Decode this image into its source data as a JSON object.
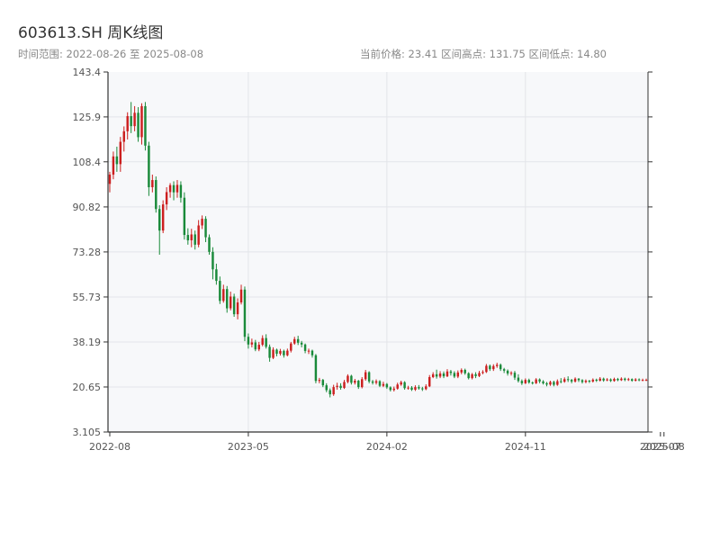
{
  "header": {
    "title": "603613.SH 周K线图",
    "range_text": "时间范围: 2022-08-26 至 2025-08-08",
    "stats_text": "当前价格: 23.41   区间高点: 131.75   区间低点: 14.80"
  },
  "colors": {
    "up": "#cc1f1f",
    "down": "#1a8a3a",
    "plot_bg": "#f7f8fa",
    "grid": "#e3e5e9",
    "axis": "#333333"
  },
  "chart_data": {
    "type": "candlestick",
    "title": "603613.SH 周K线图",
    "xlabel": "",
    "ylabel": "",
    "ylim": [
      3.105,
      143.4
    ],
    "y_ticks": [
      "3.105",
      "20.65",
      "38.19",
      "55.73",
      "73.28",
      "90.82",
      "108.4",
      "125.9",
      "143.4"
    ],
    "y_tick_values": [
      3.105,
      20.65,
      38.19,
      55.73,
      73.28,
      90.82,
      108.4,
      125.9,
      143.4
    ],
    "x_ticks": [
      "2022-08",
      "2023-05",
      "2024-02",
      "2024-11",
      "2025-07",
      "2025-08"
    ],
    "x_tick_index": [
      0,
      39,
      78,
      117,
      155,
      156
    ],
    "grid": true,
    "current_price": 23.41,
    "range_high": 131.75,
    "range_low": 14.8,
    "start": "2022-08-26",
    "end": "2025-08-08",
    "series": [
      {
        "values": [
          [
            99.8,
            103.4,
            96.5,
            104.5
          ],
          [
            103.4,
            110.5,
            101.6,
            112.4
          ],
          [
            110.5,
            107.5,
            104.5,
            114.3
          ],
          [
            107.5,
            116.2,
            104.5,
            118.1
          ],
          [
            116.2,
            120.3,
            112.4,
            122.2
          ],
          [
            120.3,
            126.2,
            117.1,
            127.7
          ],
          [
            126.2,
            122.3,
            119.6,
            131.7
          ],
          [
            122.3,
            127.5,
            120.3,
            130.1
          ],
          [
            127.5,
            118.0,
            116.2,
            129.7
          ],
          [
            118.0,
            130.1,
            115.1,
            131.2
          ],
          [
            130.1,
            114.7,
            112.8,
            131.7
          ],
          [
            114.7,
            98.5,
            95.1,
            116.2
          ],
          [
            98.5,
            101.3,
            96.5,
            103.4
          ],
          [
            101.3,
            90.0,
            88.6,
            102.7
          ],
          [
            90.0,
            81.6,
            72.2,
            91.5
          ],
          [
            81.6,
            91.8,
            80.6,
            93.4
          ],
          [
            91.8,
            96.6,
            89.6,
            98.5
          ],
          [
            96.6,
            99.3,
            94.4,
            100.1
          ],
          [
            99.3,
            96.5,
            93.4,
            100.8
          ],
          [
            96.5,
            99.4,
            94.4,
            101.3
          ],
          [
            99.4,
            94.4,
            92.5,
            100.8
          ],
          [
            94.4,
            79.9,
            78.1,
            96.5
          ],
          [
            79.9,
            77.8,
            76.1,
            82.5
          ],
          [
            77.8,
            80.1,
            75.1,
            82.3
          ],
          [
            80.1,
            76.1,
            74.2,
            81.6
          ],
          [
            76.1,
            83.6,
            75.1,
            85.7
          ],
          [
            83.6,
            86.2,
            82.2,
            87.5
          ],
          [
            86.2,
            79.0,
            77.1,
            87.2
          ],
          [
            79.0,
            73.3,
            72.2,
            80.1
          ],
          [
            73.3,
            66.5,
            62.6,
            75.1
          ],
          [
            66.5,
            62.0,
            60.5,
            68.7
          ],
          [
            62.0,
            54.2,
            53.0,
            63.7
          ],
          [
            54.2,
            58.8,
            53.5,
            60.5
          ],
          [
            58.8,
            51.3,
            49.6,
            60.0
          ],
          [
            51.3,
            55.9,
            50.5,
            57.8
          ],
          [
            55.9,
            49.0,
            48.0,
            57.0
          ],
          [
            49.0,
            53.6,
            47.0,
            55.2
          ],
          [
            53.6,
            58.6,
            52.8,
            60.5
          ],
          [
            58.6,
            40.2,
            38.5,
            59.8
          ],
          [
            40.2,
            37.2,
            35.6,
            41.5
          ],
          [
            37.2,
            38.0,
            36.1,
            39.5
          ],
          [
            38.0,
            35.3,
            34.6,
            39.0
          ],
          [
            35.3,
            37.1,
            34.6,
            38.2
          ],
          [
            37.1,
            39.7,
            36.5,
            40.8
          ],
          [
            39.7,
            36.3,
            35.6,
            41.2
          ],
          [
            36.3,
            32.0,
            30.5,
            37.2
          ],
          [
            32.0,
            35.2,
            31.5,
            36.1
          ],
          [
            35.2,
            33.6,
            32.6,
            35.6
          ],
          [
            33.6,
            34.7,
            32.9,
            35.5
          ],
          [
            34.7,
            33.0,
            32.1,
            35.2
          ],
          [
            33.0,
            34.8,
            32.6,
            35.6
          ],
          [
            34.8,
            37.6,
            34.1,
            38.2
          ],
          [
            37.6,
            39.3,
            37.1,
            40.2
          ],
          [
            39.3,
            37.9,
            37.0,
            40.6
          ],
          [
            37.9,
            37.2,
            36.1,
            38.6
          ],
          [
            37.2,
            34.7,
            33.8,
            37.6
          ],
          [
            34.7,
            34.8,
            33.5,
            35.6
          ],
          [
            34.8,
            33.0,
            32.1,
            35.2
          ],
          [
            33.0,
            23.0,
            22.1,
            33.5
          ],
          [
            23.0,
            23.4,
            22.1,
            24.2
          ],
          [
            23.4,
            21.3,
            20.6,
            23.8
          ],
          [
            21.3,
            19.4,
            18.6,
            22.1
          ],
          [
            19.4,
            17.8,
            16.6,
            20.1
          ],
          [
            17.8,
            20.6,
            17.2,
            21.5
          ],
          [
            20.6,
            21.1,
            19.6,
            22.3
          ],
          [
            21.1,
            20.3,
            19.6,
            22.1
          ],
          [
            20.3,
            22.6,
            19.9,
            23.4
          ],
          [
            22.6,
            25.0,
            22.1,
            25.6
          ],
          [
            25.0,
            22.3,
            21.6,
            25.4
          ],
          [
            22.3,
            23.1,
            21.6,
            23.8
          ],
          [
            23.1,
            20.6,
            19.9,
            23.4
          ],
          [
            20.6,
            23.7,
            20.1,
            24.5
          ],
          [
            23.7,
            26.4,
            23.1,
            27.3
          ],
          [
            26.4,
            22.8,
            22.1,
            26.8
          ],
          [
            22.8,
            22.3,
            21.6,
            23.4
          ],
          [
            22.3,
            22.9,
            21.6,
            23.6
          ],
          [
            22.9,
            21.1,
            20.6,
            23.3
          ],
          [
            21.1,
            21.8,
            20.6,
            22.7
          ],
          [
            21.8,
            20.5,
            19.9,
            22.2
          ],
          [
            20.5,
            19.5,
            18.9,
            20.9
          ],
          [
            19.5,
            20.0,
            18.9,
            20.8
          ],
          [
            20.0,
            21.6,
            19.6,
            22.3
          ],
          [
            21.6,
            22.5,
            21.1,
            23.1
          ],
          [
            22.5,
            20.2,
            19.6,
            22.9
          ],
          [
            20.2,
            20.4,
            19.6,
            21.1
          ],
          [
            20.4,
            19.6,
            19.1,
            21.0
          ],
          [
            19.6,
            20.6,
            19.1,
            21.3
          ],
          [
            20.6,
            20.1,
            19.6,
            21.4
          ],
          [
            20.1,
            19.8,
            19.1,
            20.7
          ],
          [
            19.8,
            20.9,
            19.4,
            21.7
          ],
          [
            20.9,
            24.5,
            20.6,
            25.3
          ],
          [
            24.5,
            25.6,
            24.1,
            26.4
          ],
          [
            25.6,
            24.7,
            23.9,
            27.4
          ],
          [
            24.7,
            25.9,
            24.1,
            26.8
          ],
          [
            25.9,
            24.8,
            24.1,
            26.7
          ],
          [
            24.8,
            26.7,
            24.5,
            27.6
          ],
          [
            26.7,
            26.1,
            25.1,
            27.3
          ],
          [
            26.1,
            24.7,
            24.1,
            26.8
          ],
          [
            24.7,
            26.3,
            24.1,
            27.1
          ],
          [
            26.3,
            27.3,
            25.6,
            27.9
          ],
          [
            27.3,
            26.0,
            25.4,
            27.8
          ],
          [
            26.0,
            24.1,
            23.6,
            26.4
          ],
          [
            24.1,
            25.6,
            23.6,
            26.1
          ],
          [
            25.6,
            24.9,
            24.1,
            26.4
          ],
          [
            24.9,
            26.1,
            24.5,
            26.9
          ],
          [
            26.1,
            26.5,
            25.6,
            27.2
          ],
          [
            26.5,
            28.9,
            26.1,
            29.6
          ],
          [
            28.9,
            27.6,
            26.9,
            29.4
          ],
          [
            27.6,
            28.8,
            26.9,
            29.5
          ],
          [
            28.8,
            29.3,
            28.1,
            30.1
          ],
          [
            29.3,
            27.6,
            26.9,
            29.8
          ],
          [
            27.6,
            27.0,
            26.1,
            28.1
          ],
          [
            27.0,
            25.9,
            25.1,
            27.5
          ],
          [
            25.9,
            26.2,
            25.1,
            26.8
          ],
          [
            26.2,
            24.3,
            23.4,
            26.9
          ],
          [
            24.3,
            23.0,
            22.4,
            25.6
          ],
          [
            23.0,
            22.1,
            21.4,
            23.6
          ],
          [
            22.1,
            23.4,
            21.8,
            24.0
          ],
          [
            23.4,
            22.4,
            21.9,
            23.9
          ],
          [
            22.4,
            22.1,
            21.6,
            22.8
          ],
          [
            22.1,
            23.6,
            21.8,
            24.1
          ],
          [
            23.6,
            22.8,
            22.1,
            24.0
          ],
          [
            22.8,
            22.1,
            21.6,
            23.3
          ],
          [
            22.1,
            21.6,
            20.9,
            22.6
          ],
          [
            21.6,
            22.6,
            21.1,
            23.1
          ],
          [
            22.6,
            21.5,
            20.9,
            23.1
          ],
          [
            21.5,
            22.9,
            21.1,
            23.6
          ],
          [
            22.9,
            22.7,
            22.1,
            24.1
          ],
          [
            22.7,
            23.7,
            22.3,
            24.4
          ],
          [
            23.7,
            23.4,
            22.6,
            24.8
          ],
          [
            23.4,
            22.8,
            22.1,
            23.8
          ],
          [
            22.8,
            23.9,
            22.4,
            24.4
          ],
          [
            23.9,
            23.3,
            22.6,
            24.1
          ],
          [
            23.3,
            22.6,
            22.0,
            23.7
          ],
          [
            22.6,
            23.1,
            22.1,
            23.6
          ],
          [
            23.1,
            22.8,
            22.2,
            23.4
          ],
          [
            22.8,
            23.5,
            22.4,
            24.0
          ],
          [
            23.5,
            23.1,
            22.6,
            23.9
          ],
          [
            23.1,
            23.9,
            22.8,
            24.5
          ],
          [
            23.9,
            23.2,
            22.7,
            24.3
          ],
          [
            23.2,
            23.6,
            22.9,
            24.1
          ],
          [
            23.6,
            23.0,
            22.6,
            24.0
          ],
          [
            23.0,
            23.8,
            22.7,
            24.3
          ],
          [
            23.8,
            23.3,
            22.9,
            24.2
          ],
          [
            23.3,
            23.9,
            23.0,
            24.4
          ],
          [
            23.9,
            23.4,
            22.9,
            24.3
          ],
          [
            23.4,
            23.7,
            23.0,
            24.2
          ],
          [
            23.7,
            23.1,
            22.7,
            24.0
          ],
          [
            23.1,
            23.6,
            22.8,
            24.1
          ],
          [
            23.6,
            23.3,
            22.9,
            24.0
          ],
          [
            23.3,
            23.41,
            22.9,
            23.9
          ],
          [
            23.41,
            23.41,
            23.0,
            23.9
          ]
        ]
      }
    ]
  }
}
